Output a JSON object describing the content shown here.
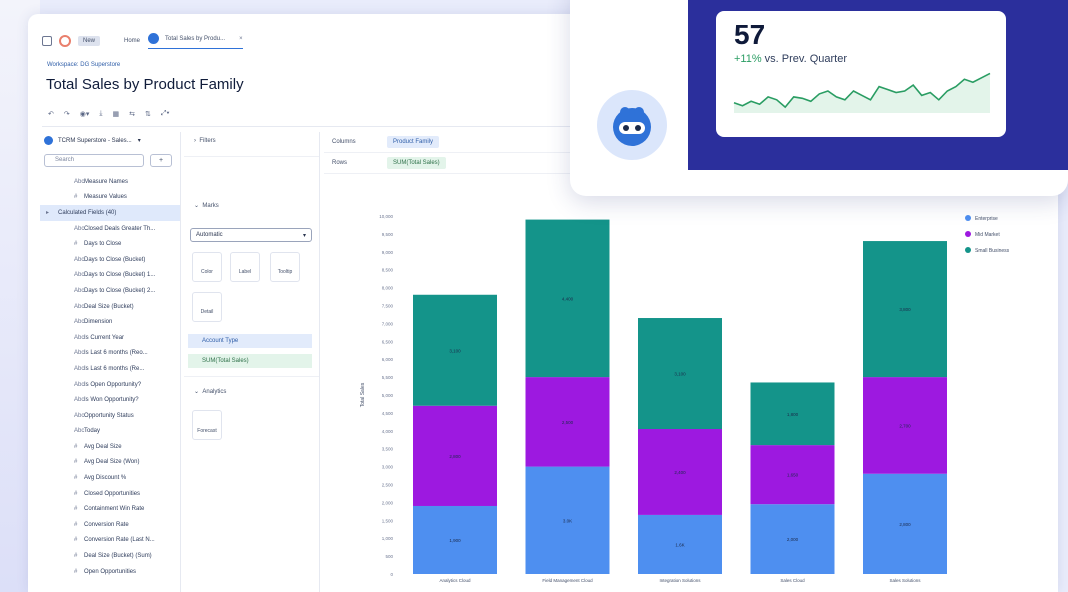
{
  "topbar": {
    "new_label": "New",
    "home_tab": "Home",
    "active_tab": "Total Sales by Produ...",
    "close_glyph": "×"
  },
  "breadcrumb": "Workspace: DG Superstore",
  "page_title": "Total Sales by Product Family",
  "toolbar_icons": [
    "undo-icon",
    "redo-icon",
    "data-icon",
    "download-icon",
    "table-icon",
    "swap-icon",
    "sort-icon",
    "expand-icon"
  ],
  "left_panel": {
    "source": "TCRM Superstore - Sales...",
    "search_placeholder": "Search",
    "add_label": "+",
    "fields": [
      {
        "icon": "Abc",
        "label": "Measure Names",
        "sel": false
      },
      {
        "icon": "#",
        "label": "Measure Values",
        "sel": false
      },
      {
        "icon": "▸",
        "label": "Calculated Fields (40)",
        "sel": true
      },
      {
        "icon": "Abc",
        "label": "Closed Deals Greater Th...",
        "sel": false
      },
      {
        "icon": "#",
        "label": "Days to Close",
        "sel": false
      },
      {
        "icon": "Abc",
        "label": "Days to Close (Bucket)",
        "sel": false
      },
      {
        "icon": "Abc",
        "label": "Days to Close (Bucket) 1...",
        "sel": false
      },
      {
        "icon": "Abc",
        "label": "Days to Close (Bucket) 2...",
        "sel": false
      },
      {
        "icon": "Abc",
        "label": "Deal Size (Bucket)",
        "sel": false
      },
      {
        "icon": "Abc",
        "label": "Dimension",
        "sel": false
      },
      {
        "icon": "Abc",
        "label": "Is Current Year",
        "sel": false
      },
      {
        "icon": "Abc",
        "label": "Is Last 6 months (Reo...",
        "sel": false
      },
      {
        "icon": "Abc",
        "label": "Is Last 6 months (Re...",
        "sel": false
      },
      {
        "icon": "Abc",
        "label": "Is Open Opportunity?",
        "sel": false
      },
      {
        "icon": "Abc",
        "label": "Is Won Opportunity?",
        "sel": false
      },
      {
        "icon": "Abc",
        "label": "Opportunity Status",
        "sel": false
      },
      {
        "icon": "Abc",
        "label": "Today",
        "sel": false
      },
      {
        "icon": "#",
        "label": "Avg Deal Size",
        "sel": false
      },
      {
        "icon": "#",
        "label": "Avg Deal Size (Won)",
        "sel": false
      },
      {
        "icon": "#",
        "label": "Avg Discount %",
        "sel": false
      },
      {
        "icon": "#",
        "label": "Closed Opportunities",
        "sel": false
      },
      {
        "icon": "#",
        "label": "Containment Win Rate",
        "sel": false
      },
      {
        "icon": "#",
        "label": "Conversion Rate",
        "sel": false
      },
      {
        "icon": "#",
        "label": "Conversion Rate (Last N...",
        "sel": false
      },
      {
        "icon": "#",
        "label": "Deal Size (Bucket) (Sum)",
        "sel": false
      },
      {
        "icon": "#",
        "label": "Open Opportunities",
        "sel": false
      }
    ]
  },
  "mid_panel": {
    "filters": "Filters",
    "marks": "Marks",
    "mark_type": "Automatic",
    "buttons": [
      "Color",
      "Label",
      "Tooltip",
      "Detail"
    ],
    "shelf_blue": "Account Type",
    "shelf_green": "SUM(Total Sales)",
    "analytics": "Analytics",
    "forecast": "Forecast"
  },
  "shelves": [
    {
      "label": "Columns",
      "pill": "Product Family",
      "kind": "blue"
    },
    {
      "label": "Rows",
      "pill": "SUM(Total Sales)",
      "kind": "green"
    }
  ],
  "chart_data": {
    "type": "bar",
    "stacked": true,
    "ylabel": "Total Sales",
    "ylim": [
      0,
      10000
    ],
    "yticks": [
      "0",
      "500",
      "1,000",
      "1,500",
      "2,000",
      "2,500",
      "3,000",
      "3,500",
      "4,000",
      "4,500",
      "5,000",
      "5,500",
      "6,000",
      "6,500",
      "7,000",
      "7,500",
      "8,000",
      "8,500",
      "9,000",
      "9,500",
      "10,000"
    ],
    "categories": [
      "Analytics Cloud",
      "Field Management Cloud",
      "Integration Solutions",
      "Sales Cloud",
      "Sales Solutions"
    ],
    "series": [
      {
        "name": "Enterprise",
        "color": "#4e8ff0",
        "values": [
          1900,
          3000,
          1650,
          1950,
          2800
        ],
        "labels": [
          "1,900",
          "3.0K",
          "1.6K",
          "2,000",
          "2,800"
        ]
      },
      {
        "name": "Mid Market",
        "color": "#9d19e0",
        "values": [
          2800,
          2500,
          2400,
          1650,
          2700
        ],
        "labels": [
          "2,800",
          "2,500",
          "2,400",
          "1,650",
          "2,700"
        ]
      },
      {
        "name": "Small Business",
        "color": "#14948a",
        "values": [
          3100,
          4400,
          3100,
          1750,
          3800
        ],
        "labels": [
          "3,100",
          "4,400",
          "3,100",
          "1,800",
          "3,800"
        ]
      }
    ]
  },
  "kpi_card": {
    "value": "57",
    "change": "+11%",
    "change_text": " vs. Prev. Quarter",
    "spark": [
      22,
      20,
      23,
      21,
      26,
      24,
      19,
      26,
      25,
      23,
      28,
      30,
      26,
      24,
      30,
      27,
      24,
      33,
      31,
      29,
      30,
      34,
      27,
      29,
      24,
      30,
      33,
      38,
      36,
      39,
      42
    ]
  }
}
